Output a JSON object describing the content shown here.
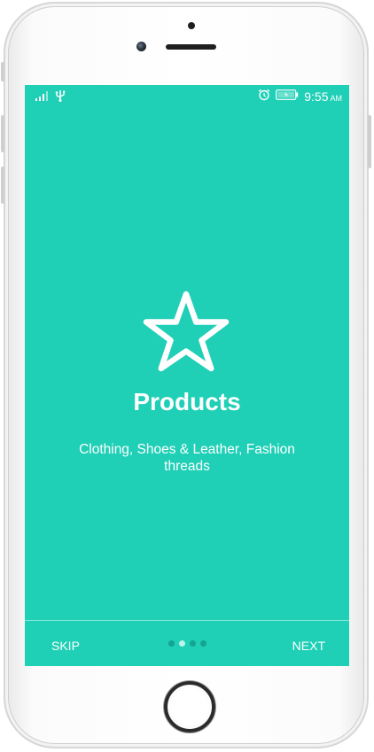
{
  "status_bar": {
    "time": "9:55",
    "ampm": "AM",
    "icons": [
      "signal-icon",
      "usb-icon",
      "alarm-icon",
      "battery-icon"
    ]
  },
  "onboarding": {
    "icon": "star-icon",
    "title": "Products",
    "subtitle": "Clothing, Shoes & Leather, Fashion threads",
    "page_current": 2,
    "page_total": 4
  },
  "nav": {
    "skip_label": "SKIP",
    "next_label": "NEXT"
  },
  "colors": {
    "screen_bg": "#1fcfb6",
    "dot_inactive": "#17a391",
    "dot_active": "#bff3ea",
    "text": "#ffffff"
  }
}
